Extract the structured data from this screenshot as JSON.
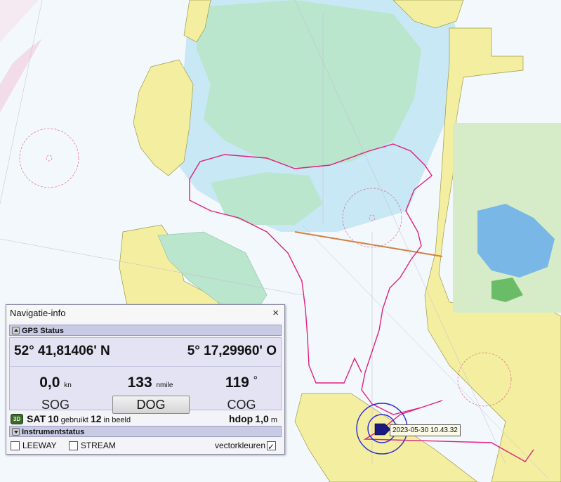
{
  "panel": {
    "title": "Navigatie-info",
    "close_glyph": "×",
    "gps_section": "GPS Status",
    "latitude": "52° 41,81406' N",
    "longitude": "5° 17,29960' O",
    "sog_value": "0,0",
    "sog_unit": "kn",
    "sog_label": "SOG",
    "dog_value": "133",
    "dog_unit": "nmile",
    "dog_button": "DOG",
    "cog_value": "119",
    "cog_unit": "°",
    "cog_label": "COG",
    "fix_badge": "3D",
    "sat_label": "SAT",
    "sat_used": "10",
    "sat_used_text": "gebruikt",
    "sat_visible": "12",
    "sat_visible_text": "in beeld",
    "hdop_label": "hdop",
    "hdop_value": "1,0",
    "hdop_unit": "m",
    "instrument_section": "Instrumentstatus",
    "leeway_label": "LEEWAY",
    "leeway_checked": false,
    "stream_label": "STREAM",
    "stream_checked": false,
    "vector_label": "vectorkleuren",
    "vector_checked": true
  },
  "map": {
    "timestamp": "2023-05-30 10.43.32",
    "colors": {
      "water_deep": "#f3f8fc",
      "water_shallow": "#c7e8f4",
      "flats": "#b9e6cc",
      "land": "#f4eea0",
      "route": "#e0207e",
      "range_ring": "#2a2ad0"
    },
    "icons": [
      "vessel-icon",
      "range-ring-icon",
      "compass-rose-icon"
    ]
  }
}
